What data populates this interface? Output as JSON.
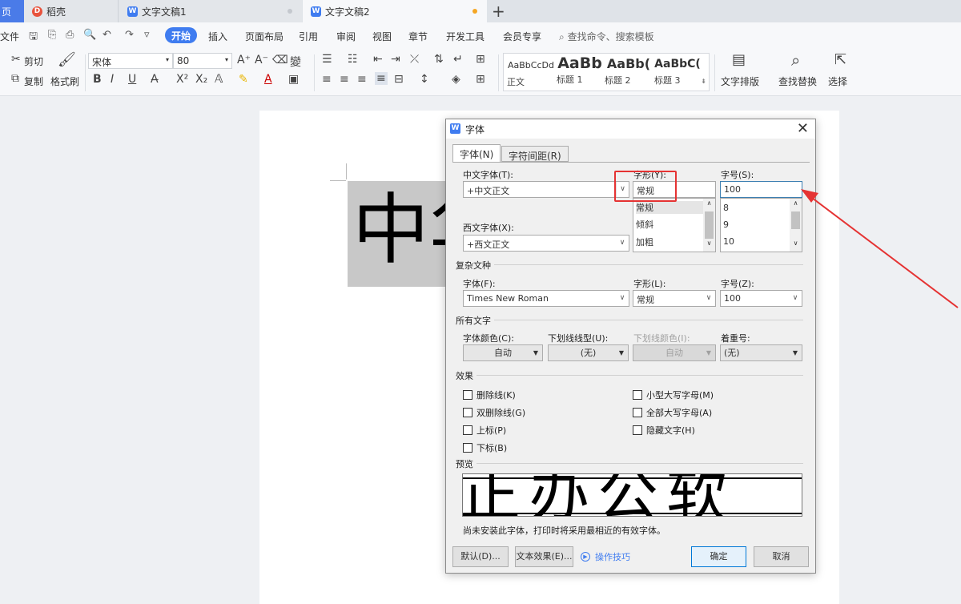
{
  "tabs": {
    "home": "页",
    "daoke": "稻壳",
    "doc1": "文字文稿1",
    "doc2": "文字文稿2"
  },
  "menu": {
    "file": "文件",
    "start": "开始",
    "items": [
      "插入",
      "页面布局",
      "引用",
      "审阅",
      "视图",
      "章节",
      "开发工具",
      "会员专享"
    ],
    "search": "查找命令、搜索模板"
  },
  "ribbon": {
    "cut": "剪切",
    "copy": "复制",
    "format_painter": "格式刷",
    "font_name": "宋体",
    "font_size": "80",
    "styles": [
      {
        "preview": "AaBbCcDd",
        "label": "正文"
      },
      {
        "preview": "AaBb",
        "label": "标题 1"
      },
      {
        "preview": "AaBb(",
        "label": "标题 2"
      },
      {
        "preview": "AaBbC(",
        "label": "标题 3"
      }
    ],
    "text_layout": "文字排版",
    "find_replace": "查找替换",
    "select": "选择"
  },
  "document": {
    "selected_text": "中华"
  },
  "dialog": {
    "title": "字体",
    "tab_font": "字体(N)",
    "tab_spacing": "字符间距(R)",
    "cn_font_label": "中文字体(T):",
    "cn_font_value": "+中文正文",
    "style_label": "字形(Y):",
    "style_value": "常规",
    "size_label": "字号(S):",
    "size_value": "100",
    "style_list": [
      "常规",
      "倾斜",
      "加粗"
    ],
    "size_list": [
      "8",
      "9",
      "10"
    ],
    "west_font_label": "西文字体(X):",
    "west_font_value": "+西文正文",
    "complex_group": "复杂文种",
    "complex_font_label": "字体(F):",
    "complex_font_value": "Times New Roman",
    "complex_style_label": "字形(L):",
    "complex_style_value": "常规",
    "complex_size_label": "字号(Z):",
    "complex_size_value": "100",
    "all_text_group": "所有文字",
    "color_label": "字体颜色(C):",
    "color_value": "自动",
    "underline_label": "下划线线型(U):",
    "underline_value": "(无)",
    "underline_color_label": "下划线颜色(I):",
    "underline_color_value": "自动",
    "emphasis_label": "着重号:",
    "emphasis_value": "(无)",
    "effects_group": "效果",
    "effects_left": [
      "删除线(K)",
      "双删除线(G)",
      "上标(P)",
      "下标(B)"
    ],
    "effects_right": [
      "小型大写字母(M)",
      "全部大写字母(A)",
      "隐藏文字(H)"
    ],
    "preview_group": "预览",
    "preview_text": "正办公软",
    "note": "尚未安装此字体，打印时将采用最相近的有效字体。",
    "btn_default": "默认(D)...",
    "btn_text_effects": "文本效果(E)...",
    "tips": "操作技巧",
    "btn_ok": "确定",
    "btn_cancel": "取消"
  },
  "colors": {
    "accent": "#3f7cf0",
    "annotation": "#e53333"
  }
}
